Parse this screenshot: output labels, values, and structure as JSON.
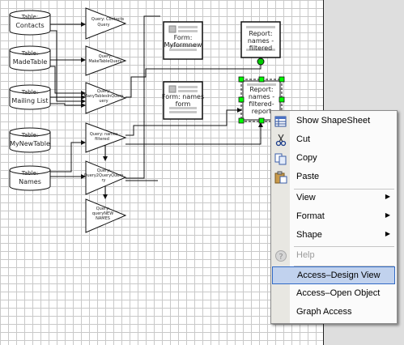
{
  "shapes": {
    "tables": [
      {
        "title": "Table:",
        "name": "Contacts"
      },
      {
        "title": "Table:",
        "name": "MadeTable"
      },
      {
        "title": "Table:",
        "name": "Mailing List"
      },
      {
        "title": "Table:",
        "name": "MyNewTable"
      },
      {
        "title": "Table:",
        "name": "Names"
      }
    ],
    "queries": [
      {
        "line1": "Query: Contacts",
        "line2": "Query"
      },
      {
        "line1": "Query:",
        "line2": "MakeTableQuery"
      },
      {
        "line1": "Query:",
        "line2": "ManyTablesInQuery",
        "line3": "uery"
      },
      {
        "line1": "Query: names -",
        "line2": "filtered"
      },
      {
        "line1": "Query:",
        "line2": "Query2QueryQuery",
        "line3": "ry"
      },
      {
        "line1": "Query:",
        "line2": "queryNEW",
        "line3": "NAMES"
      }
    ],
    "forms": [
      {
        "line1": "Form:",
        "line2": "Myformnew"
      },
      {
        "line1": "Form: names",
        "line2": "form"
      }
    ],
    "reports": [
      {
        "line1": "Report:",
        "line2": "names -",
        "line3": "filtered"
      },
      {
        "line1": "Report:",
        "line2": "names -",
        "line3": "filtered-",
        "line4": "report"
      }
    ]
  },
  "context_menu": {
    "items": [
      {
        "label": "Show ShapeSheet",
        "icon": "shapesheet-icon",
        "disabled": false,
        "submenu": false,
        "highlighted": false
      },
      {
        "label": "Cut",
        "icon": "scissors-icon",
        "disabled": false,
        "submenu": false,
        "highlighted": false
      },
      {
        "label": "Copy",
        "icon": "copy-icon",
        "disabled": false,
        "submenu": false,
        "highlighted": false
      },
      {
        "label": "Paste",
        "icon": "paste-icon",
        "disabled": false,
        "submenu": false,
        "highlighted": false
      },
      {
        "label": "View",
        "icon": "",
        "disabled": false,
        "submenu": true,
        "highlighted": false
      },
      {
        "label": "Format",
        "icon": "",
        "disabled": false,
        "submenu": true,
        "highlighted": false
      },
      {
        "label": "Shape",
        "icon": "",
        "disabled": false,
        "submenu": true,
        "highlighted": false
      },
      {
        "label": "Help",
        "icon": "help-icon",
        "disabled": true,
        "submenu": false,
        "highlighted": false
      },
      {
        "label": "Access–Design View",
        "icon": "",
        "disabled": false,
        "submenu": false,
        "highlighted": true
      },
      {
        "label": "Access–Open Object",
        "icon": "",
        "disabled": false,
        "submenu": false,
        "highlighted": false
      },
      {
        "label": "Graph Access",
        "icon": "",
        "disabled": false,
        "submenu": false,
        "highlighted": false
      }
    ]
  },
  "colors": {
    "workspace": "#6f7a87",
    "menu_highlight": "#c1d2ee",
    "selection_handle": "#00ff00",
    "connector_glue": "#00cc00"
  }
}
